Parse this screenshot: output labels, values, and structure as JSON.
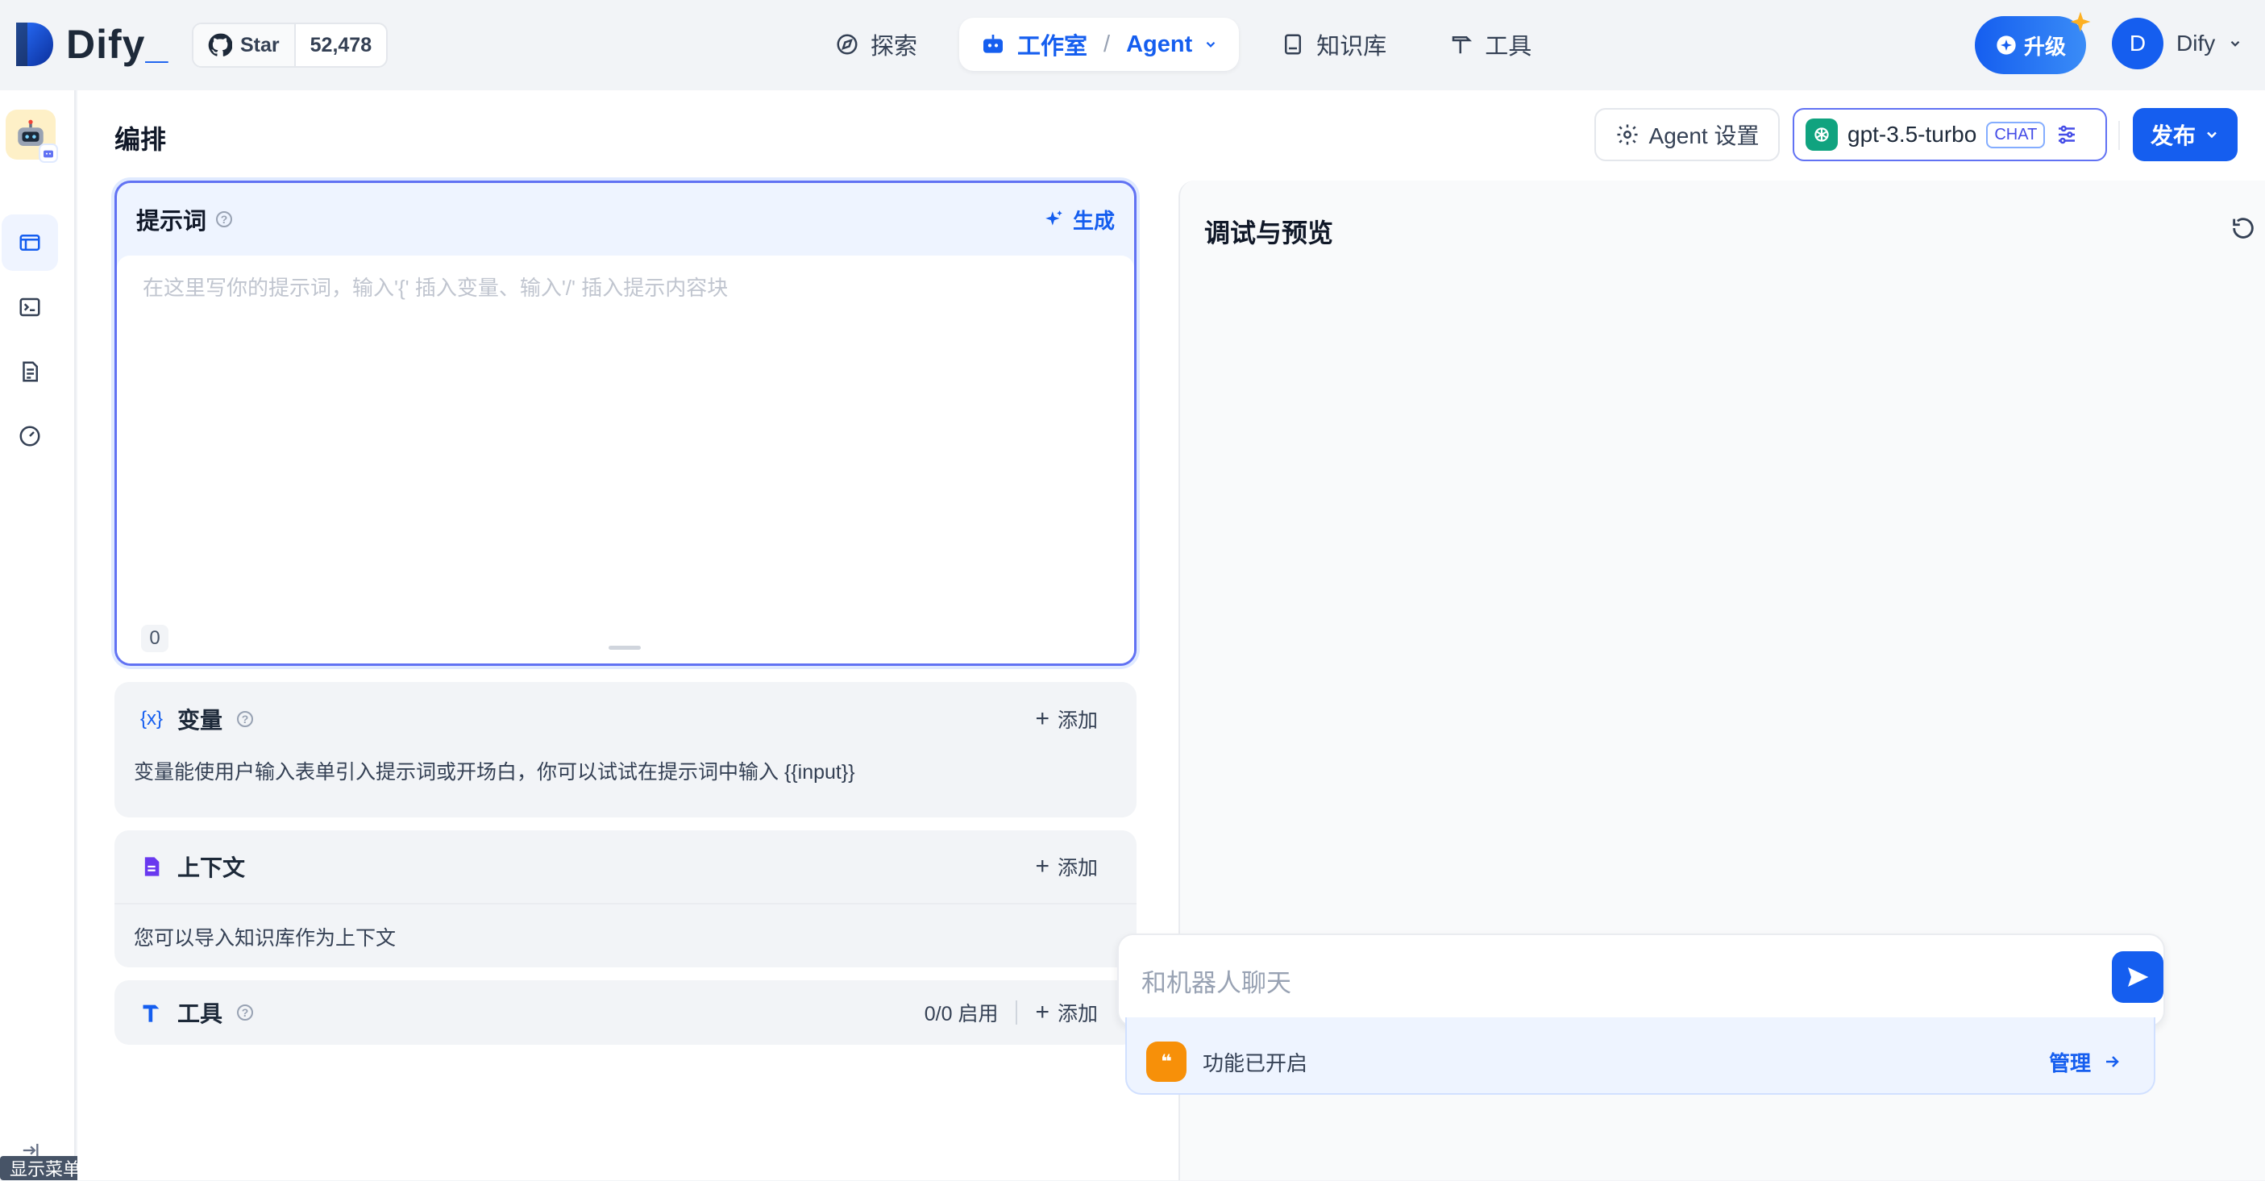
{
  "brand": {
    "name": "Dify",
    "mark_color": "#155eef"
  },
  "github": {
    "label": "Star",
    "count": "52,478"
  },
  "nav": {
    "explore": "探索",
    "studio": "工作室",
    "agent": "Agent",
    "knowledge": "知识库",
    "tools": "工具"
  },
  "upgrade": {
    "label": "升级"
  },
  "user": {
    "initial": "D",
    "name": "Dify"
  },
  "header": {
    "title": "编排",
    "agent_settings": "Agent 设置",
    "model": "gpt-3.5-turbo",
    "model_mode": "CHAT",
    "publish": "发布"
  },
  "prompt": {
    "title": "提示词",
    "generate": "生成",
    "placeholder": "在这里写你的提示词，输入'{' 插入变量、输入'/' 插入提示内容块",
    "count": "0"
  },
  "variables": {
    "icon": "{x}",
    "title": "变量",
    "add": "添加",
    "desc": "变量能使用户输入表单引入提示词或开场白，你可以试试在提示词中输入 {{input}}"
  },
  "context": {
    "title": "上下文",
    "add": "添加",
    "desc": "您可以导入知识库作为上下文"
  },
  "tools_section": {
    "title": "工具",
    "status": "0/0 启用",
    "add": "添加"
  },
  "debug": {
    "title": "调试与预览",
    "chat_placeholder": "和机器人聊天",
    "features_enabled": "功能已开启",
    "manage": "管理"
  },
  "sidebar": {
    "tooltip": "显示菜单"
  },
  "colors": {
    "primary": "#155eef",
    "accent_border": "#6172f3",
    "gpt": "#10a37f",
    "feature": "#f79009"
  }
}
